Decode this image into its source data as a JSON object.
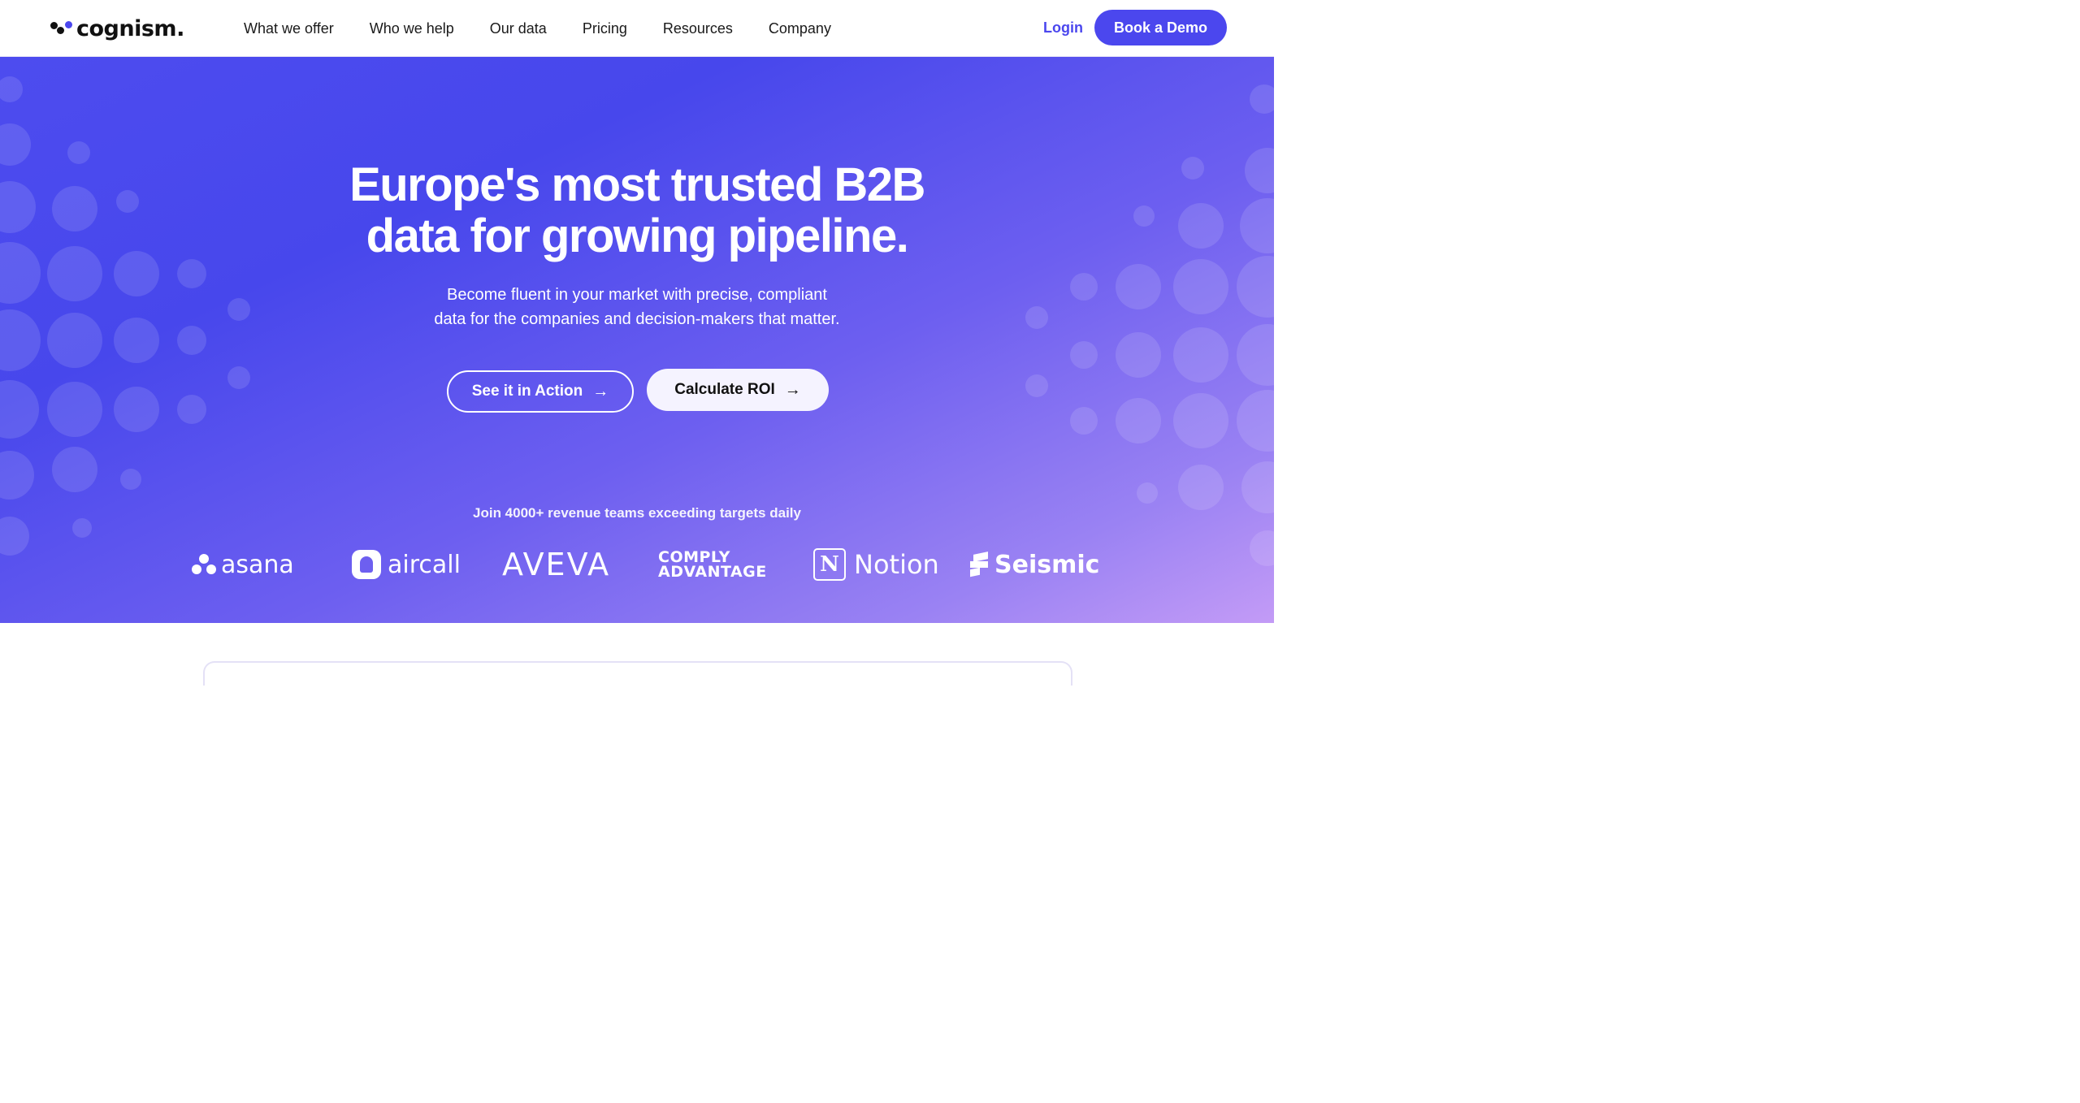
{
  "header": {
    "logo_text": "cognism.",
    "nav": [
      "What we offer",
      "Who we help",
      "Our data",
      "Pricing",
      "Resources",
      "Company"
    ],
    "login_label": "Login",
    "demo_label": "Book a Demo"
  },
  "hero": {
    "title_line1": "Europe's most trusted B2B",
    "title_line2": "data for growing pipeline.",
    "subtitle_line1": "Become fluent in your market with precise, compliant",
    "subtitle_line2": "data for the companies and decision-makers that matter.",
    "cta_primary": "See it in Action",
    "cta_secondary": "Calculate ROI",
    "tagline": "Join 4000+ revenue teams exceeding targets daily"
  },
  "customers": {
    "asana": "asana",
    "aircall": "aircall",
    "aveva": "AVEVA",
    "comply_line1": "COMPLY",
    "comply_line2": "ADVANTAGE",
    "notion_mark": "N",
    "notion": "Notion",
    "seismic": "Seismic"
  },
  "colors": {
    "brand": "#4b47ee",
    "hero_gradient_start": "#4747ec",
    "hero_gradient_end": "#c39bf6"
  }
}
